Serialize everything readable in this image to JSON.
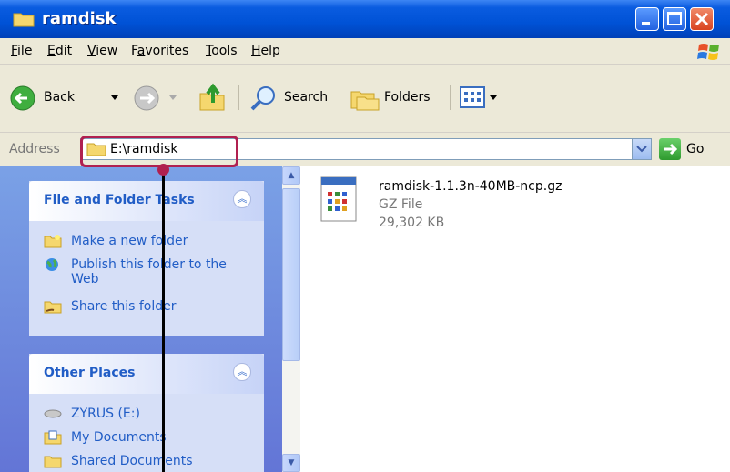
{
  "window": {
    "title": "ramdisk"
  },
  "menu": {
    "items": [
      "File",
      "Edit",
      "View",
      "Favorites",
      "Tools",
      "Help"
    ],
    "underline_letters": [
      "F",
      "E",
      "V",
      "a",
      "T",
      "H"
    ]
  },
  "toolbar": {
    "back_label": "Back",
    "search_label": "Search",
    "folders_label": "Folders"
  },
  "address": {
    "label": "Address",
    "value": "E:\\ramdisk",
    "go_label": "Go"
  },
  "file_tasks": {
    "title": "File and Folder Tasks",
    "items": [
      "Make a new folder",
      "Publish this folder to the Web",
      "Share this folder"
    ]
  },
  "other_places": {
    "title": "Other Places",
    "items": [
      "ZYRUS (E:)",
      "My Documents",
      "Shared Documents"
    ]
  },
  "file": {
    "name": "ramdisk-1.1.3n-40MB-ncp.gz",
    "type": "GZ File",
    "size": "29,302 KB"
  },
  "colors": {
    "titlebar": "#0052d6",
    "task_link": "#215dc6",
    "callout": "#b02050"
  }
}
